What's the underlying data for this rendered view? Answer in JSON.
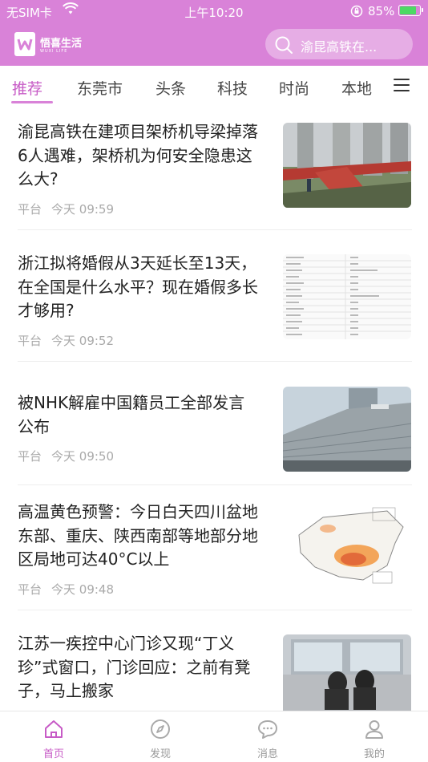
{
  "status_bar": {
    "carrier": "无SIM卡",
    "time": "上午10:20",
    "battery_percent": "85%",
    "battery_level": 0.85,
    "icons": [
      "wifi-icon",
      "orientation-lock-icon",
      "battery-charging-icon"
    ]
  },
  "header": {
    "logo_text": "悟喜生活",
    "logo_sub": "WUXI LIFE",
    "search_placeholder": "渝昆高铁在...",
    "search_icon": "search-icon",
    "accent_color": "#d982d8"
  },
  "tabs": [
    {
      "label": "推荐",
      "active": true
    },
    {
      "label": "东莞市",
      "active": false
    },
    {
      "label": "头条",
      "active": false
    },
    {
      "label": "科技",
      "active": false
    },
    {
      "label": "时尚",
      "active": false
    },
    {
      "label": "本地",
      "active": false
    }
  ],
  "articles": [
    {
      "title": "渝昆高铁在建项目架桥机导梁掉落6人遇难，架桥机为何安全隐患这么大?",
      "source": "平台",
      "time": "今天 09:59",
      "image": "collapsed-bridge-girder-photo"
    },
    {
      "title": "浙江拟将婚假从3天延长至13天，在全国是什么水平？现在婚假多长才够用?",
      "source": "平台",
      "time": "今天 09:52",
      "image": "marriage-leave-table-image"
    },
    {
      "title": "被NHK解雇中国籍员工全部发言公布",
      "source": "平台",
      "time": "今天 09:50",
      "image": "nhk-building-photo"
    },
    {
      "title": "高温黄色预警：今日白天四川盆地东部、重庆、陕西南部等地部分地区局地可达40°C以上",
      "source": "平台",
      "time": "今天 09:48",
      "image": "china-heat-map-image"
    },
    {
      "title": "江苏一疾控中心门诊又现“丁义珍”式窗口，门诊回应：之前有凳子，马上搬家",
      "source": "",
      "time": "",
      "image": "clinic-window-photo"
    }
  ],
  "bottom_nav": [
    {
      "label": "首页",
      "icon": "home-icon",
      "active": true
    },
    {
      "label": "发现",
      "icon": "compass-icon",
      "active": false
    },
    {
      "label": "消息",
      "icon": "message-icon",
      "active": false
    },
    {
      "label": "我的",
      "icon": "user-icon",
      "active": false
    }
  ]
}
